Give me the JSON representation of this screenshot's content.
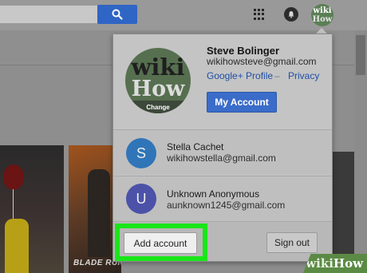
{
  "topbar": {
    "search_icon": "search-icon",
    "apps_icon": "apps-grid-icon",
    "notifications_icon": "bell-icon",
    "avatar_line1": "wiki",
    "avatar_line2": "How"
  },
  "posters": {
    "blade_runner_title": "BLADE RUNNER"
  },
  "account_panel": {
    "avatar_line1": "wiki",
    "avatar_line2": "How",
    "change_label": "Change",
    "user_name": "Steve Bolinger",
    "user_email": "wikihowsteve@gmail.com",
    "google_plus_link": "Google+ Profile",
    "separator": "–",
    "privacy_link": "Privacy",
    "my_account_button": "My Account",
    "accounts": [
      {
        "initial": "S",
        "name": "Stella Cachet",
        "email": "wikihowstella@gmail.com",
        "color": "#2f75b8"
      },
      {
        "initial": "U",
        "name": "Unknown Anonymous",
        "email": "aunknown1245@gmail.com",
        "color": "#4b52a8"
      }
    ],
    "add_account_button": "Add account",
    "sign_out_button": "Sign out"
  },
  "watermark": {
    "wiki": "wiki",
    "how": "How"
  },
  "colors": {
    "search_button": "#2f65c4",
    "my_account_button": "#3a6cc9",
    "highlight": "#19e619"
  }
}
